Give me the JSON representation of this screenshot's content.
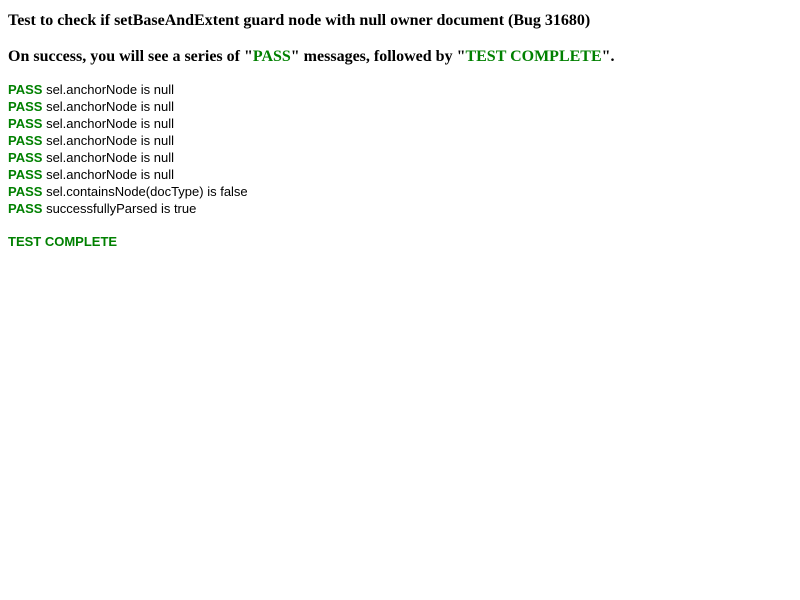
{
  "title": "Test to check if setBaseAndExtent guard node with null owner document (Bug 31680)",
  "instructions": {
    "prefix": "On success, you will see a series of \"",
    "pass_word": "PASS",
    "middle": "\" messages, followed by \"",
    "complete_word": "TEST COMPLETE",
    "suffix": "\"."
  },
  "results": [
    {
      "status": "PASS",
      "message": "sel.anchorNode is null"
    },
    {
      "status": "PASS",
      "message": "sel.anchorNode is null"
    },
    {
      "status": "PASS",
      "message": "sel.anchorNode is null"
    },
    {
      "status": "PASS",
      "message": "sel.anchorNode is null"
    },
    {
      "status": "PASS",
      "message": "sel.anchorNode is null"
    },
    {
      "status": "PASS",
      "message": "sel.anchorNode is null"
    },
    {
      "status": "PASS",
      "message": "sel.containsNode(docType) is false"
    },
    {
      "status": "PASS",
      "message": "successfullyParsed is true"
    }
  ],
  "complete_text": "TEST COMPLETE",
  "colors": {
    "pass": "#008000",
    "text": "#000000",
    "background": "#ffffff"
  }
}
